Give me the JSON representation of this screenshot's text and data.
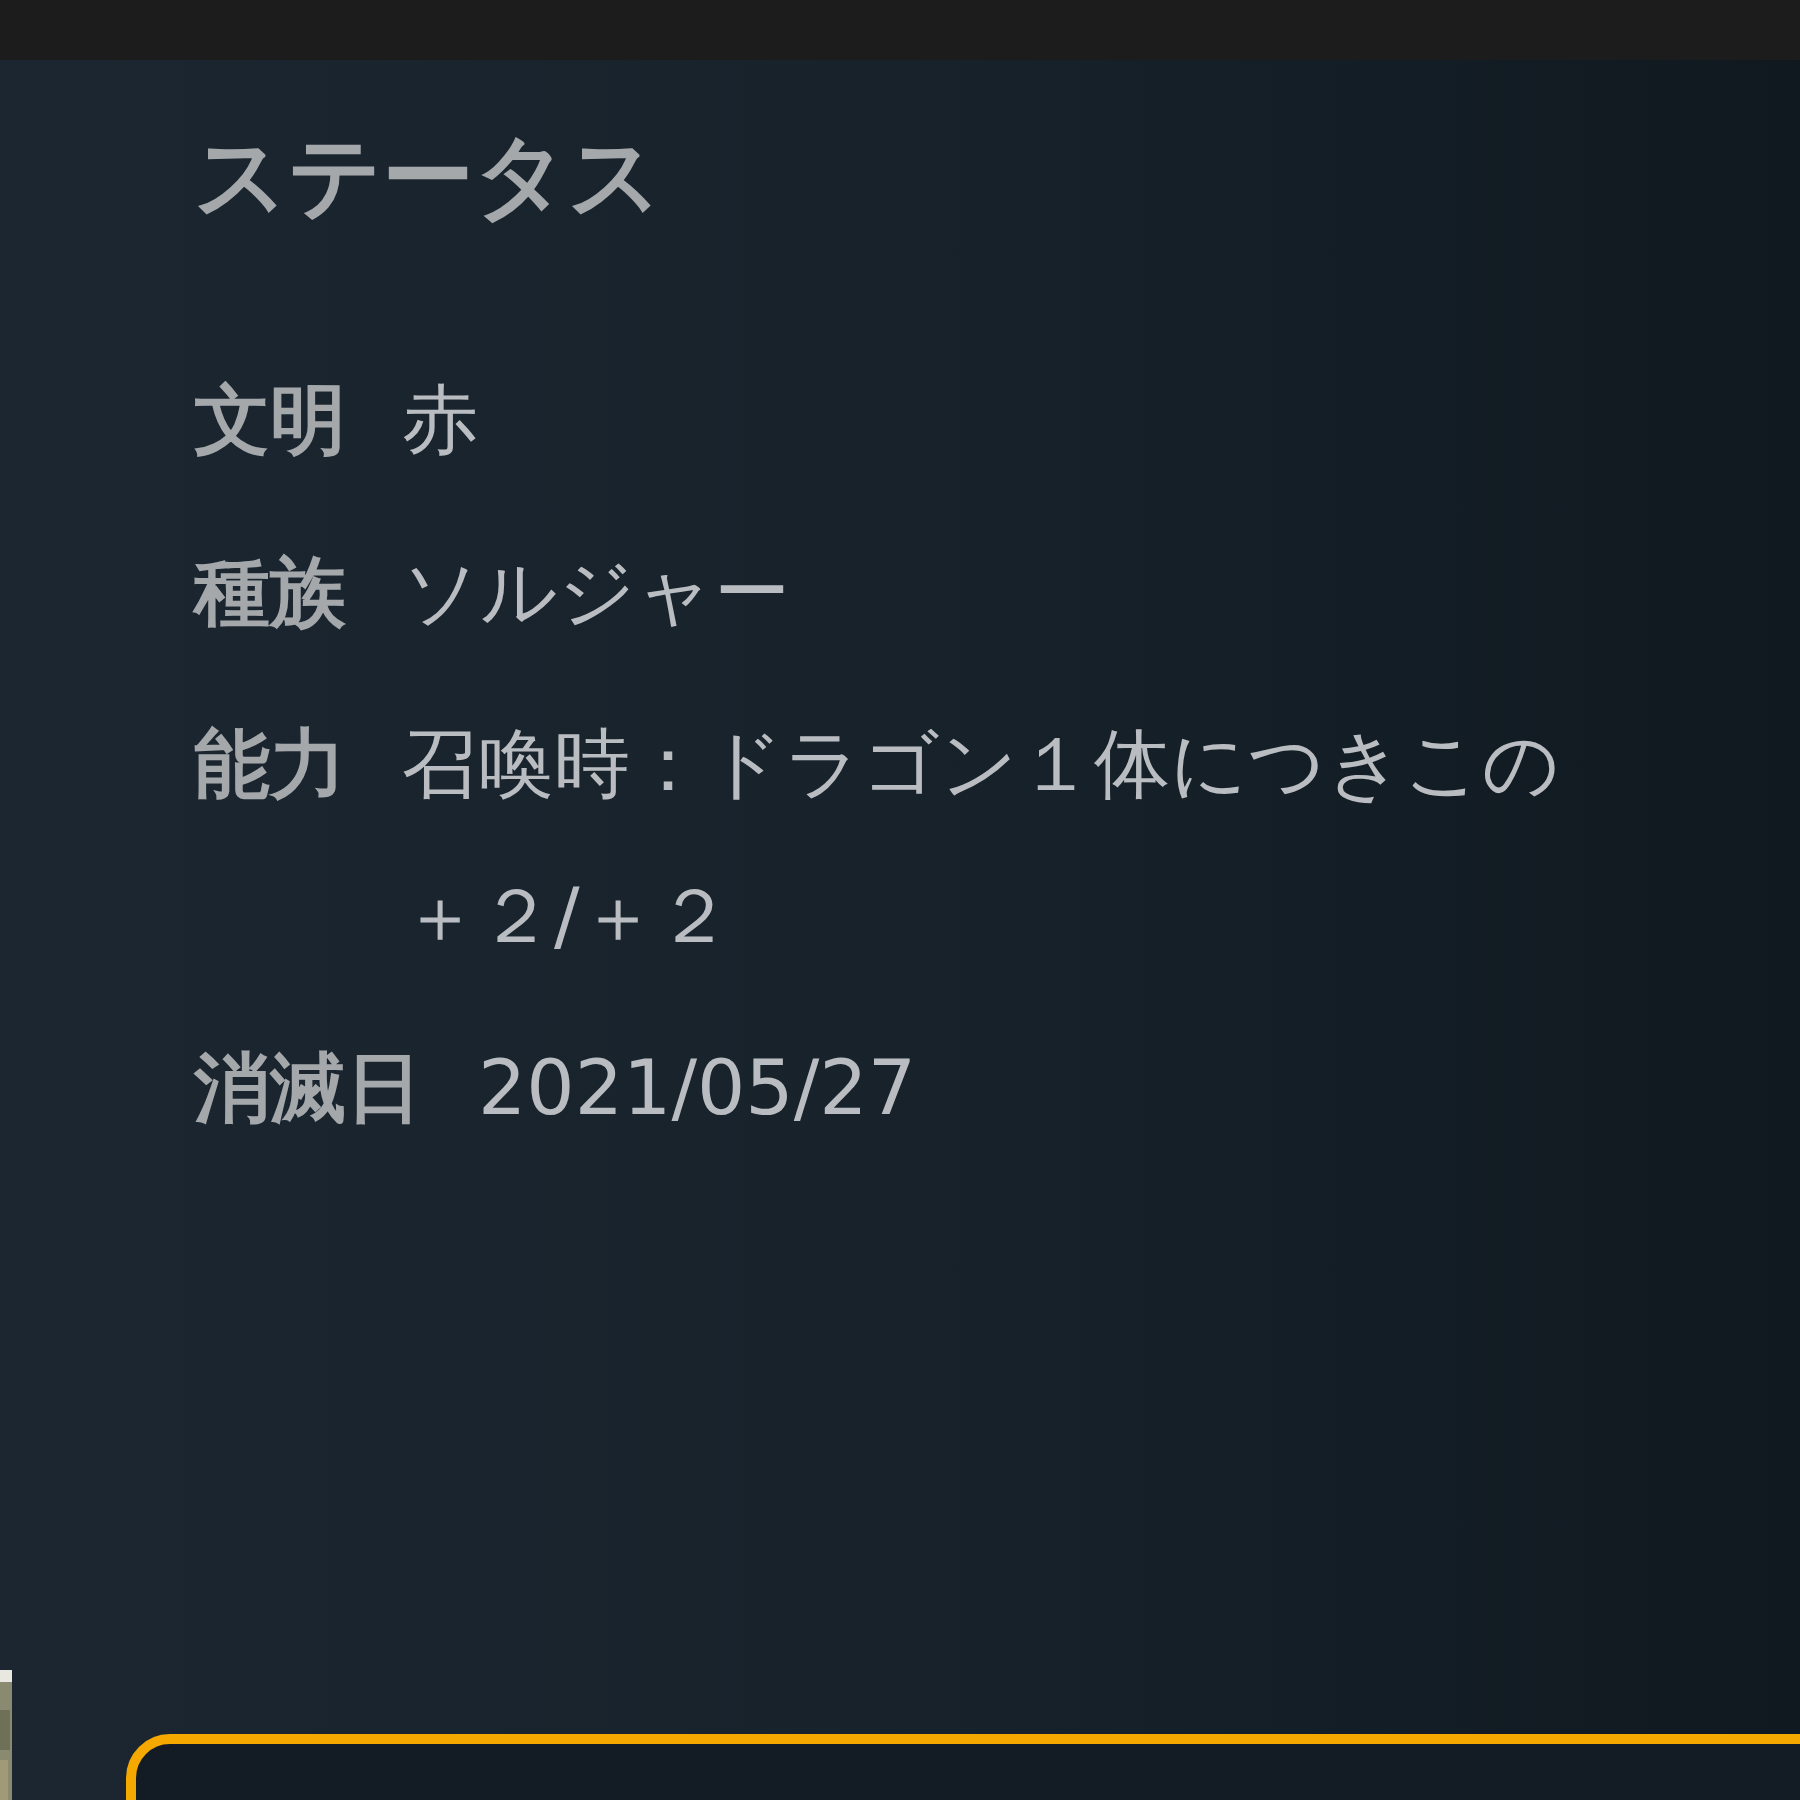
{
  "section_title": "ステータス",
  "fields": [
    {
      "label": "文明",
      "lines": [
        "赤"
      ]
    },
    {
      "label": "種族",
      "lines": [
        "ソルジャー"
      ]
    },
    {
      "label": "能力",
      "lines": [
        "召喚時：ドラゴン１体につきこの",
        "＋２/＋２"
      ]
    },
    {
      "label": "消滅日",
      "lines": [
        "2021/05/27"
      ]
    }
  ],
  "bottom_card": {
    "kind": "highlighted"
  }
}
